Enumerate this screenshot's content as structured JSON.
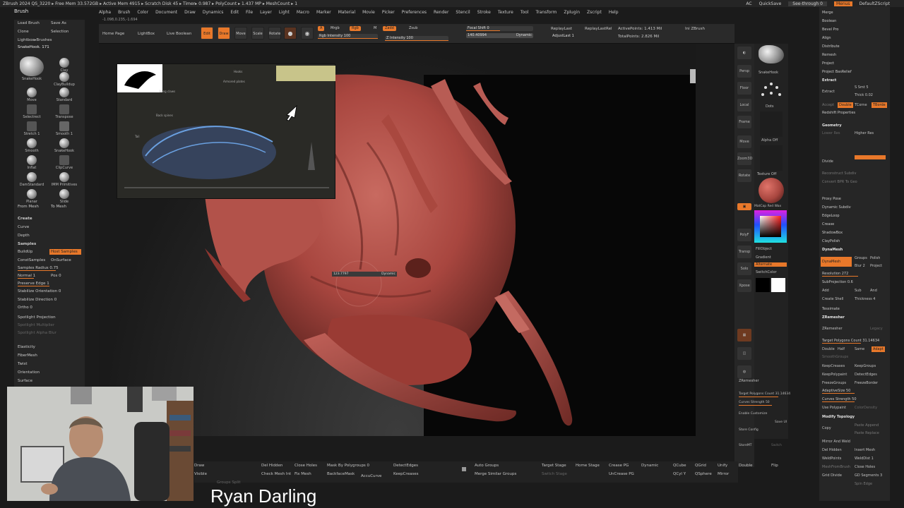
{
  "titlebar": {
    "title": "ZBrush 2024   QS_3220   ▸ Free Mem 33.572GB ▸ Active Mem 4915 ▸ Scratch Disk 45 ▸ Timer▸ 0.987 ▸ PolyCount ▸ 1.437 MP ▸ MeshCount ▸ 1",
    "right_items": [
      "AC",
      "QuickSave",
      "See-through 0",
      "Menus",
      "DefaultZScript"
    ]
  },
  "tool_title": "Brush",
  "stats_line": "-1.098,0.235,-1.694",
  "menus": [
    "Alpha",
    "Brush",
    "Color",
    "Document",
    "Draw",
    "Dynamics",
    "Edit",
    "File",
    "Layer",
    "Light",
    "Macro",
    "Marker",
    "Material",
    "Movie",
    "Picker",
    "Preferences",
    "Render",
    "Stencil",
    "Stroke",
    "Texture",
    "Tool",
    "Transform",
    "Zplugin",
    "Zscript",
    "Help"
  ],
  "topshelf": {
    "home_page": "Home Page",
    "lightbox": "LightBox",
    "live_boolean": "Live Boolean",
    "edit": "Edit",
    "draw": "Draw",
    "move": "Move",
    "scale": "Scale",
    "rotate": "Rotate",
    "a_label": "A",
    "mrgb": "Mrgb",
    "rgb": "Rgb",
    "m": "M",
    "zadd": "Zadd",
    "zsub": "Zsub",
    "rgb_intensity": "Rgb Intensity 100",
    "z_intensity": "Z Intensity 100",
    "focal_shift": "Focal Shift 0",
    "draw_size": "140.40994",
    "dynamic": "Dynamic",
    "replay_last": "ReplayLast",
    "replay_last_rel": "ReplayLastRel",
    "adjust_last": "AdjustLast 1",
    "active_points": "ActivePoints: 1.413 Mil",
    "total_points": "TotalPoints: 2.826 Mil",
    "ini_zbrush": "Ini ZBrush"
  },
  "leftpanel": {
    "load_brush": "Load Brush",
    "save_as": "Save As",
    "clone": "Clone",
    "selection": "Selection",
    "lightbox_brushes": "Lightbox▸Brushes",
    "current_brush": "SnakeHook. 171",
    "brushes": [
      "SnakeHook",
      "Clay",
      "ClayBuildup",
      "Move",
      "Standard",
      "Selectrect",
      "Transpose",
      "Stretch 1",
      "Smooth 1",
      "Smooth",
      "SnakeHook",
      "Inflat",
      "ClipCurve",
      "DamStandard",
      "IMM Primitives",
      "Planar",
      "Slide",
      "From Mesh",
      "To Mesh"
    ],
    "sections": [
      "Create",
      "Curve",
      "Depth",
      "Samples"
    ],
    "buildup": "BuildUp",
    "host_samples": "Host Samples",
    "const_samples": "ConstSamples",
    "on_surface": "OnSurface",
    "samples_radius": "Samples Radius 0.75",
    "normal": "Normal 1",
    "pos": "Pos 0",
    "preserve_edge": "Preserve Edge 1",
    "stabilize_orientation": "Stabilize Orientation 0",
    "stabilize_direction": "Stabilize Direction 0",
    "ortho": "Ortho 0",
    "spotlight_projection": "Spotlight Projection",
    "spotlight_multiplier": "Spotlight Multiplier",
    "spotlight_alpha_blur": "Spotlight Alpha Blur",
    "sections2": [
      "Elasticity",
      "FiberMesh",
      "Twist",
      "Orientation",
      "Surface"
    ]
  },
  "viewport": {
    "cursor_readout": "123.7797",
    "cursor_mode": "Dynamic"
  },
  "rshelf": [
    "Persp",
    "Floor",
    "Local",
    "Frame",
    "Move",
    "Zoom3D",
    "Rotate",
    "PolyF",
    "Transp",
    "Solo",
    "Xpose"
  ],
  "matcol": {
    "brush_name": "SnakeHook",
    "stroke": "Dots",
    "alpha": "Alpha Off",
    "texture": "Texture Off",
    "material": "MatCap Red Wax",
    "fill_object": "FillObject",
    "gradient": "Gradient",
    "alternate": "Alternate",
    "switch_color": "SwitchColor"
  },
  "rtray": {
    "items": [
      "Merge",
      "Boolean",
      "Bevel Pro",
      "Align",
      "Distribute",
      "Remesh",
      "Project",
      "Project BasRelief"
    ],
    "extract": "Extract",
    "s_smt": "S Smt 5",
    "thick": "Thick 0.02",
    "accept": "Accept",
    "double": "Double",
    "tcorne": "TCorne",
    "tborde": "TBorde",
    "redshift": "Redshift Properties",
    "geometry": "Geometry",
    "lower_res": "Lower Res",
    "higher_res": "Higher Res",
    "divide": "Divide",
    "reconstruct": "Reconstruct Subdiv",
    "convert_bpr": "Convert BPR To Geo",
    "proxy_pose": "Proxy Pose",
    "dynamic_subdiv": "Dynamic Subdiv",
    "edgeloop": "EdgeLoop",
    "crease": "Crease",
    "shadowbox": "ShadowBox",
    "claypolish": "ClayPolish",
    "dynamesh": "DynaMesh",
    "dynamesh_btn": "DynaMesh",
    "groups": "Groups",
    "polish": "Polish",
    "blur": "Blur 2",
    "project_btn": "Project",
    "resolution": "Resolution 272",
    "subprojection": "SubProjection 0.6",
    "add": "Add",
    "sub": "Sub",
    "and": "And",
    "create_shell": "Create Shell",
    "thickness": "Thickness 4",
    "tessimate": "Tessimate",
    "zremesher": "ZRemesher",
    "zremesher_btn": "ZRemesher",
    "legacy": "Legacy",
    "target_polygons": "Target Polygons Count 31.14634",
    "half": "Half",
    "same": "Same",
    "adapt": "Adapt",
    "smoothgroups": "SmoothGroups",
    "keepcreases": "KeepCreases",
    "keepgroups": "KeepGroups",
    "keeppolypaint": "KeepPolypaint",
    "detectedges": "DetectEdges",
    "freezegroups": "FreezeGroups",
    "freezeborder": "FreezeBorder",
    "adaptivesize": "AdaptiveSize 50",
    "curves_strength": "Curves Strength 50",
    "use_polypaint": "Use Polypaint",
    "colordensity": "ColorDensity",
    "modify_topology": "Modify Topology",
    "copy": "Copy",
    "paste_append": "Paste Append",
    "paste_replace": "Paste Replace",
    "mirror_weld": "Mirror And Weld",
    "del_hidden": "Del Hidden",
    "insert_mesh": "Insert Mesh",
    "weld_points": "WeldPoints",
    "weld_dist": "WeldDist 1",
    "mesh_from_brush": "MeshFromBrush",
    "close_holes": "Close Holes",
    "grid_divide": "Grid Divide",
    "gd_segments": "GD Segments 3",
    "spin_edge": "Spin Edge"
  },
  "midcol": {
    "zremesher": "ZRemesher",
    "target_polygons": "Target Polygons Count 31.14634",
    "curves_strength": "Curves Strength 50",
    "enable_customize": "Enable Customize",
    "save_ui": "Save UI",
    "store_config": "Store Config",
    "store_mt": "StoreMT",
    "switch": "Switch"
  },
  "bottomshelf": {
    "row1": [
      "Del Hidden",
      "Close Holes",
      "Mask By Polygroups 0",
      "DetectEdges",
      "Auto Groups",
      "Target Stage",
      "Home Stage",
      "Crease PG",
      "Dynamic",
      "QCube",
      "QGrid",
      "Unify",
      "Double",
      "Flip"
    ],
    "row2": [
      "Check Mesh Int",
      "Fix Mesh",
      "BackfaceMask",
      "AccuCurve",
      "KeepCreases",
      "Merge Similar Groups",
      "Switch Stage",
      "UnCrease PG",
      "QCyl Y",
      "QSphere",
      "Mirror"
    ],
    "left_labels": [
      "Draw",
      "Visible",
      "Groups Split"
    ]
  },
  "reference_labels": [
    "Hooks",
    "Armored plates",
    "Long claws",
    "Back spines",
    "Tail"
  ],
  "presenter_name": "Ryan Darling",
  "colors": {
    "accent": "#e8782a",
    "panel": "#262626",
    "sculpt": "#a8463f",
    "viewport_dark": "#070707"
  }
}
